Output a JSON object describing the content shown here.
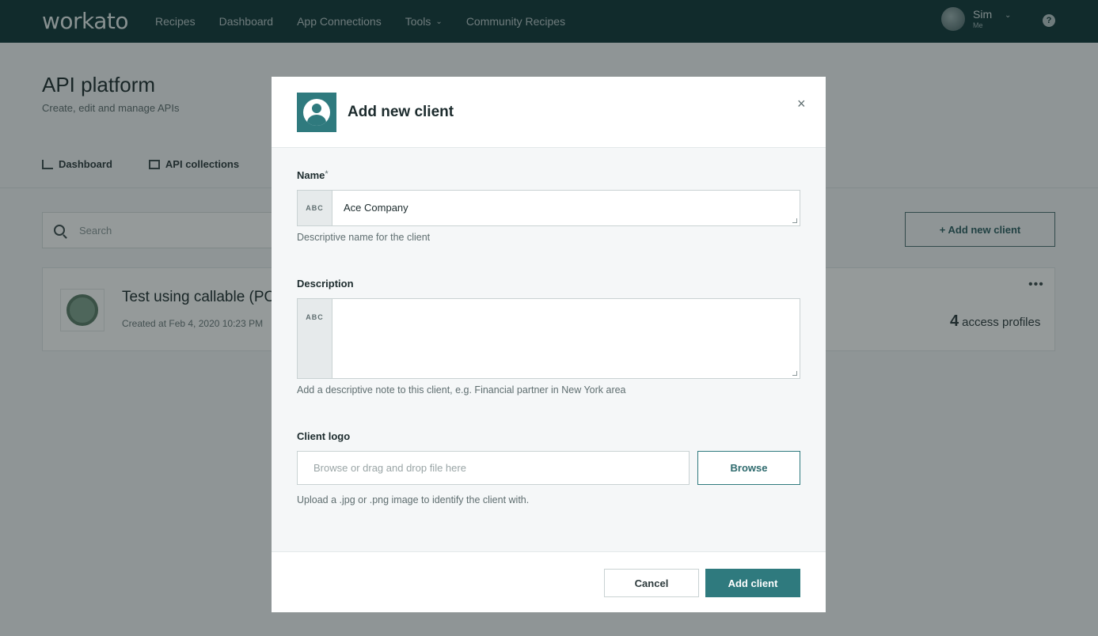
{
  "app": {
    "logo": "workato"
  },
  "nav": {
    "links": [
      "Recipes",
      "Dashboard",
      "App Connections",
      "Tools",
      "Community Recipes"
    ],
    "user_name": "Sim",
    "user_sub": "Me",
    "help": "?"
  },
  "page": {
    "title": "API platform",
    "subtitle": "Create, edit and manage APIs",
    "tabs": [
      "Dashboard",
      "API collections"
    ],
    "search_placeholder": "Search",
    "add_button": "+ Add new client",
    "card": {
      "title": "Test using callable (PO",
      "date": "Created at Feb 4, 2020 10:23 PM",
      "menu": "•••",
      "profiles_count": "4",
      "profiles_label": "access profiles"
    }
  },
  "modal": {
    "title": "Add new client",
    "close": "×",
    "name_label": "Name",
    "name_required": "*",
    "name_prefix": "ABC",
    "name_value": "Ace Company",
    "name_hint": "Descriptive name for the client",
    "desc_label": "Description",
    "desc_prefix": "ABC",
    "desc_value": "",
    "desc_hint": "Add a descriptive note to this client, e.g. Financial partner in New York area",
    "logo_label": "Client logo",
    "logo_placeholder": "Browse or drag and drop file here",
    "browse": "Browse",
    "logo_hint": "Upload a .jpg or .png image to identify the client with.",
    "cancel": "Cancel",
    "submit": "Add client"
  }
}
